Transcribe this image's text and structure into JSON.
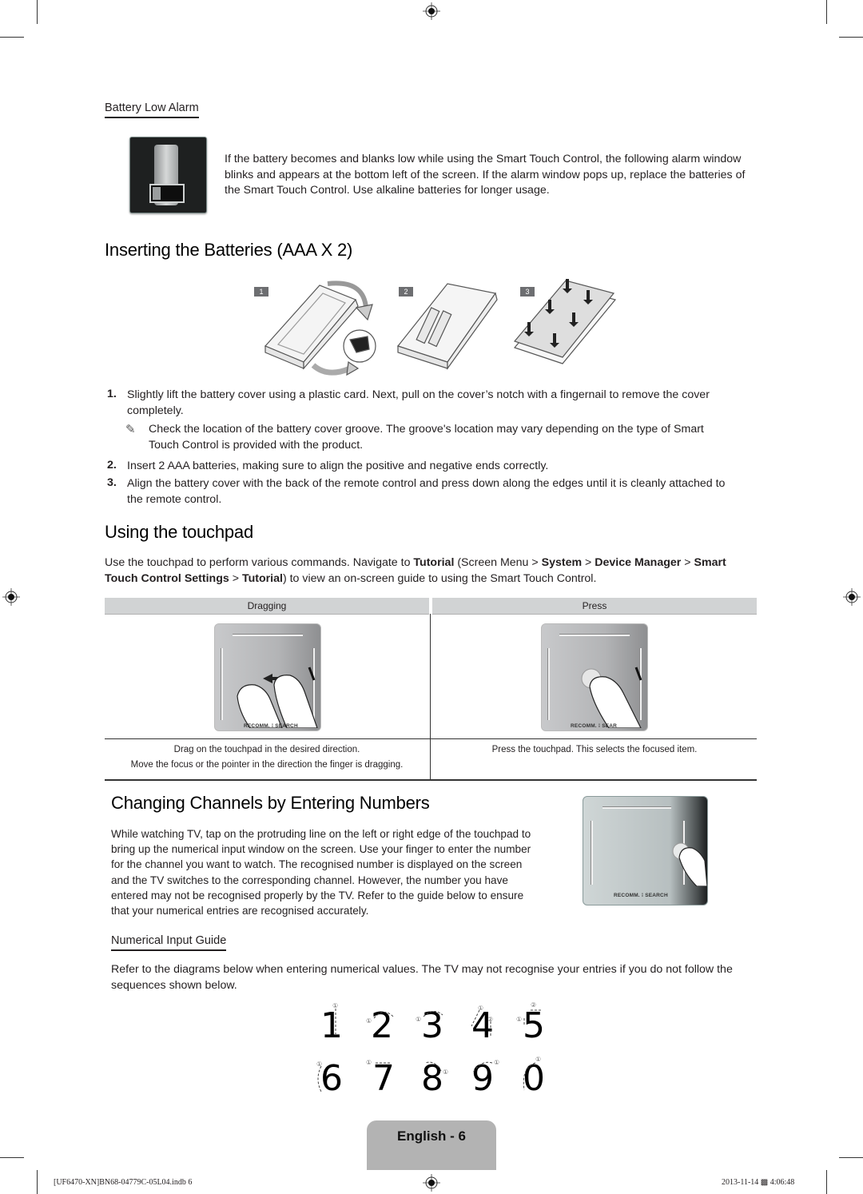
{
  "battery_low": {
    "heading": "Battery Low Alarm",
    "text": "If the battery becomes and blanks low while using the Smart Touch Control, the following alarm window blinks and appears at the bottom left of the screen. If the alarm window pops up, replace the batteries of the Smart Touch Control. Use alkaline batteries for longer usage."
  },
  "inserting": {
    "title": "Inserting the Batteries (AAA X 2)",
    "step_badges": [
      "1",
      "2",
      "3"
    ],
    "steps": [
      {
        "num": "1.",
        "text": "Slightly lift the battery cover using a plastic card. Next, pull on the cover’s notch with a fingernail to remove the cover completely."
      },
      {
        "num": "2.",
        "text": "Insert 2 AAA batteries, making sure to align the positive and negative ends correctly."
      },
      {
        "num": "3.",
        "text": "Align the battery cover with the back of the remote control and press down along the edges until it is cleanly attached to the remote control."
      }
    ],
    "note_icon": "✎",
    "note": "Check the location of the battery cover groove. The groove's location may vary depending on the type of Smart Touch Control is provided with the product."
  },
  "touchpad": {
    "title": "Using the touchpad",
    "intro": {
      "t1": "Use the touchpad to perform various commands. Navigate to ",
      "b1": "Tutorial",
      "t2": " (Screen Menu > ",
      "b2": "System",
      "t3": " > ",
      "b3": "Device Manager",
      "t4": " > ",
      "b4": "Smart Touch Control Settings",
      "t5": " > ",
      "b5": "Tutorial",
      "t6": ") to view an on-screen guide to using the Smart Touch Control."
    },
    "columns": [
      {
        "header": "Dragging",
        "caption_1": "Drag on the touchpad in the desired direction.",
        "caption_2": "Move the focus or the pointer in the direction the finger is dragging.",
        "pad_label": "RECOMM. ⁞ SEARCH"
      },
      {
        "header": "Press",
        "caption_1": "Press the touchpad. This selects the focused item.",
        "caption_2": "",
        "pad_label": "RECOMM. ⁞ SEAR"
      }
    ]
  },
  "channels": {
    "title": "Changing Channels by Entering Numbers",
    "text": "While watching TV, tap on the protruding line on the left or right edge of the touchpad to bring up the numerical input window on the screen. Use your finger to enter the number for the channel you want to watch. The recognised number is displayed on the screen and the TV switches to the corresponding channel. However, the number you have entered may not be recognised properly by the TV. Refer to the guide below to ensure that your numerical entries are recognised accurately.",
    "pad_label": "RECOMM. ⁞ SEARCH",
    "guide_heading": "Numerical Input Guide",
    "guide_text": "Refer to the diagrams below when entering numerical values. The TV may not recognise your entries if you do not follow the sequences shown below.",
    "digits_row1": [
      "1",
      "2",
      "3",
      "4",
      "5"
    ],
    "digits_row2": [
      "6",
      "7",
      "8",
      "9",
      "0"
    ],
    "stroke_marker": "①",
    "stroke_marker_2": "②"
  },
  "footer": {
    "page_label": "English - 6",
    "file": "[UF6470-XN]BN68-04779C-05L04.indb   6",
    "timestamp": "2013-11-14   ▩ 4:06:48"
  }
}
